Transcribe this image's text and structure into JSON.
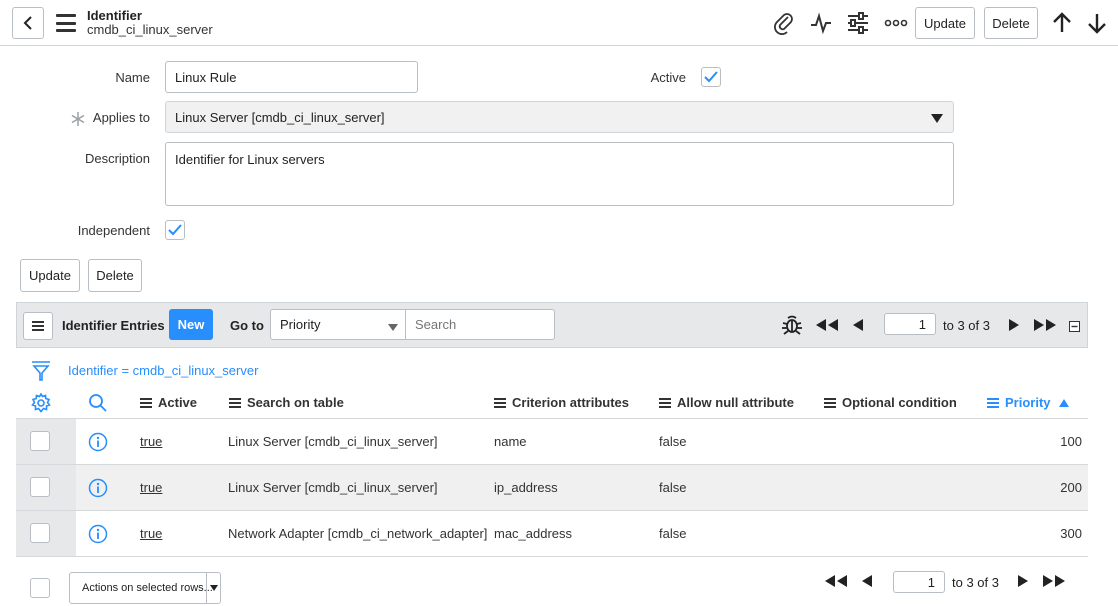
{
  "header": {
    "title": "Identifier",
    "subtitle": "cmdb_ci_linux_server",
    "update_label": "Update",
    "delete_label": "Delete",
    "icons": [
      "back-icon",
      "menu-icon",
      "attachment-icon",
      "activity-icon",
      "settings-sliders-icon",
      "more-icon",
      "arrow-up-icon",
      "arrow-down-icon"
    ]
  },
  "form": {
    "name_label": "Name",
    "name_value": "Linux Rule",
    "active_label": "Active",
    "active_checked": true,
    "applies_label": "Applies to",
    "applies_value": "Linux Server [cmdb_ci_linux_server]",
    "description_label": "Description",
    "description_value": "Identifier for Linux servers",
    "independent_label": "Independent",
    "independent_checked": true,
    "update_label": "Update",
    "delete_label": "Delete"
  },
  "list": {
    "title": "Identifier Entries",
    "new_label": "New",
    "goto_label": "Go to",
    "goto_field": "Priority",
    "search_placeholder": "Search",
    "page_value": "1",
    "page_range": "to 3 of 3",
    "filter_text": "Identifier = cmdb_ci_linux_server",
    "columns": {
      "active": "Active",
      "search_table": "Search on table",
      "criterion": "Criterion attributes",
      "allow_null": "Allow null attribute",
      "optional": "Optional condition",
      "priority": "Priority"
    },
    "rows": [
      {
        "active": "true",
        "table": "Linux Server [cmdb_ci_linux_server]",
        "criterion": "name",
        "allow_null": "false",
        "optional": "",
        "priority": "100"
      },
      {
        "active": "true",
        "table": "Linux Server [cmdb_ci_linux_server]",
        "criterion": "ip_address",
        "allow_null": "false",
        "optional": "",
        "priority": "200"
      },
      {
        "active": "true",
        "table": "Network Adapter [cmdb_ci_network_adapter]",
        "criterion": "mac_address",
        "allow_null": "false",
        "optional": "",
        "priority": "300"
      }
    ],
    "actions_label": "Actions on selected rows...",
    "footer_page_value": "1",
    "footer_page_range": "to 3 of 3"
  },
  "colors": {
    "accent": "#278efc",
    "toolbar_bg": "#e6e8ea",
    "border": "#b8bec4",
    "row_alt": "#f0f0f0"
  }
}
